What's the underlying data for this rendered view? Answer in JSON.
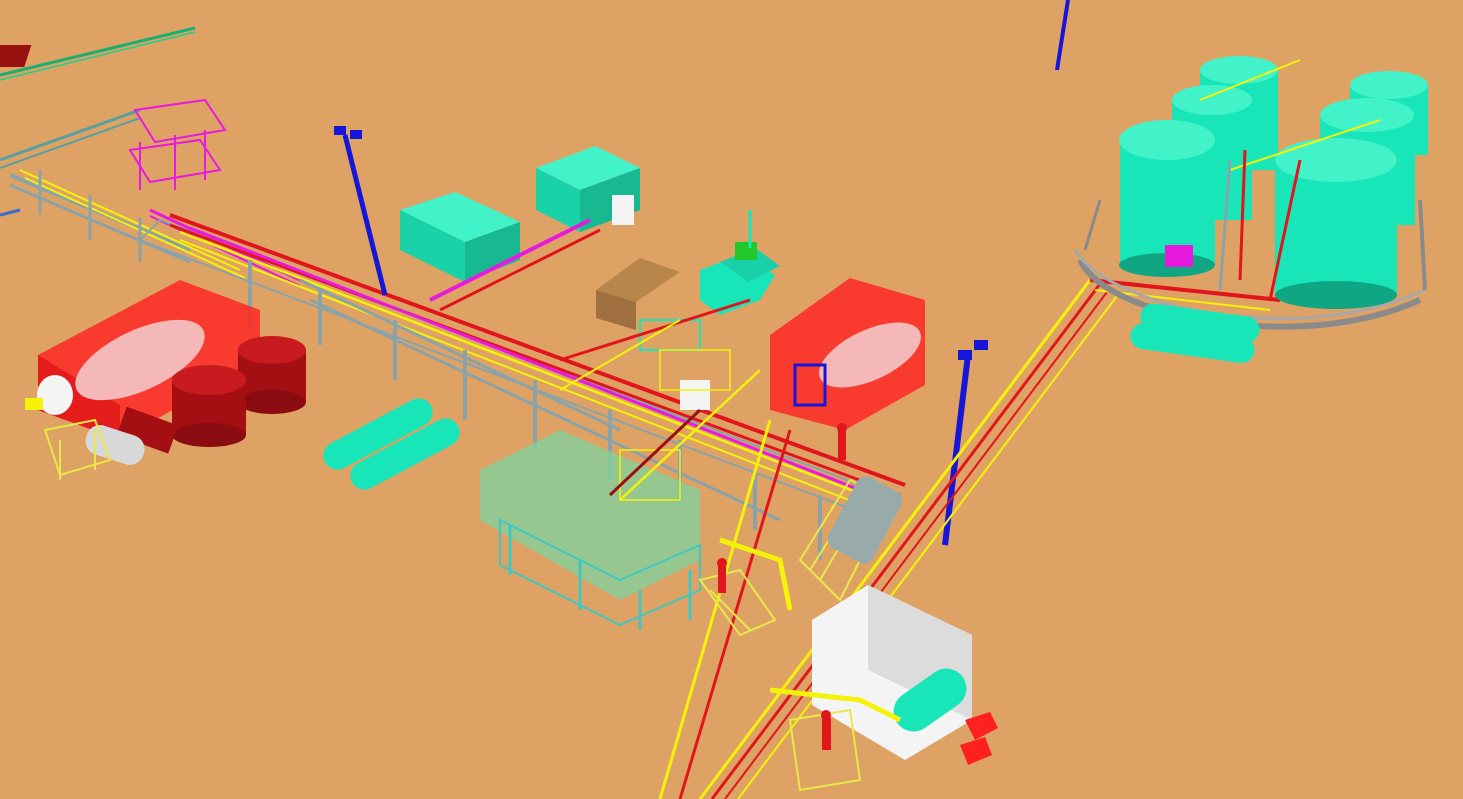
{
  "scene": {
    "description_visible_text": "",
    "colors": {
      "ground": "#dfa265",
      "pipe_yellow": "#f5f20a",
      "pipe_red": "#e0161c",
      "pipe_magenta": "#e81ae0",
      "pipe_blue": "#1616d8",
      "structure_steel": "#8aa3a8",
      "tank_cyan": "#18e6b8",
      "tank_cyan_shadow": "#0fa683",
      "vessel_red": "#a40f14",
      "enclosure_red": "#ff2020",
      "enclosure_green": "#7fd3a0",
      "white_wall": "#f4f4f4",
      "handrail_yellow": "#e8e84a",
      "dark_red_box": "#9a1010"
    }
  }
}
